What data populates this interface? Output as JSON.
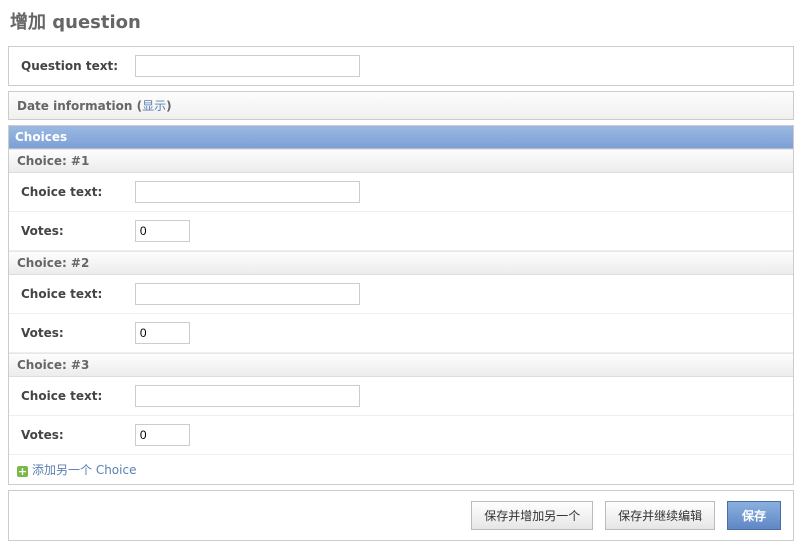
{
  "page_title": "增加 question",
  "question_field": {
    "label": "Question text:",
    "value": ""
  },
  "date_section": {
    "title": "Date information",
    "toggle": "显示"
  },
  "choices_section": {
    "title": "Choices",
    "choice_text_label": "Choice text:",
    "votes_label": "Votes:",
    "items": [
      {
        "header": "Choice: #1",
        "text": "",
        "votes": "0"
      },
      {
        "header": "Choice: #2",
        "text": "",
        "votes": "0"
      },
      {
        "header": "Choice: #3",
        "text": "",
        "votes": "0"
      }
    ],
    "add_another": "添加另一个 Choice"
  },
  "submit": {
    "save_add_another": "保存并增加另一个",
    "save_continue": "保存并继续编辑",
    "save": "保存"
  }
}
